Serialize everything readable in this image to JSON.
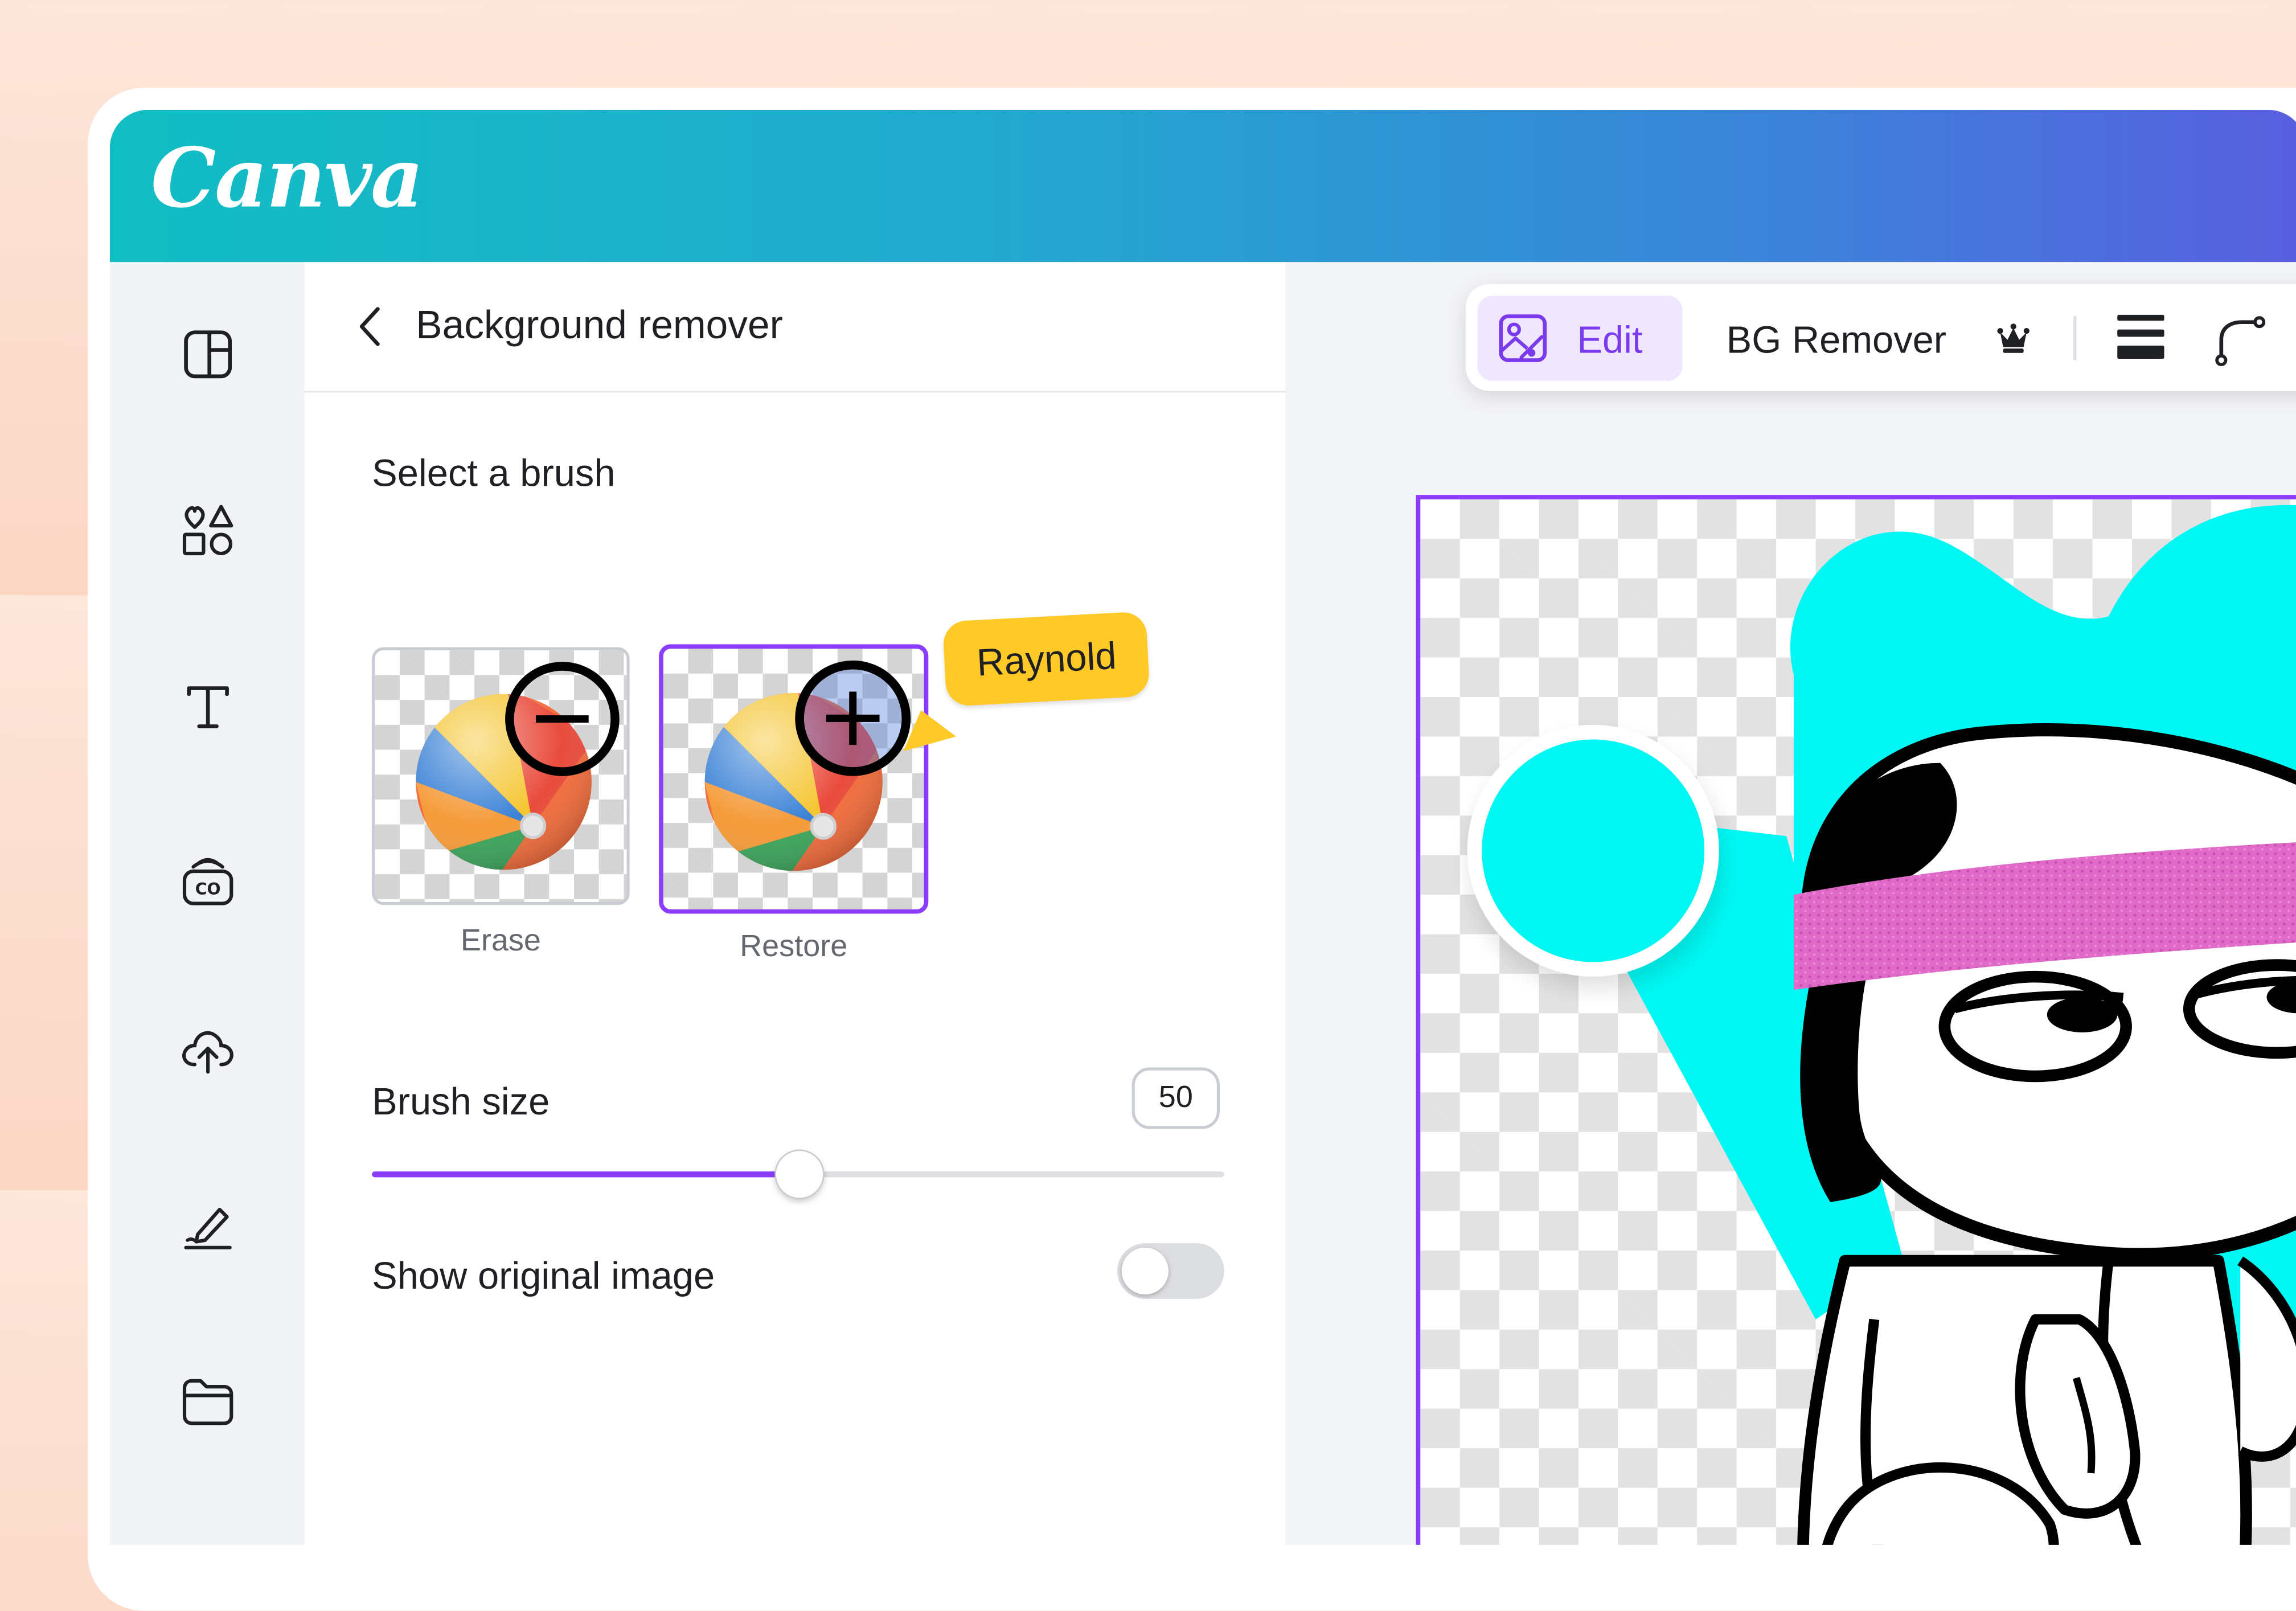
{
  "app": {
    "logo_text": "Canva"
  },
  "sidebar": {
    "items": [
      {
        "icon": "layout-panel-icon"
      },
      {
        "icon": "elements-shapes-icon"
      },
      {
        "icon": "text-icon"
      },
      {
        "icon": "brand-co-icon"
      },
      {
        "icon": "cloud-upload-icon"
      },
      {
        "icon": "draw-pen-icon"
      },
      {
        "icon": "folder-icon"
      }
    ]
  },
  "panel": {
    "title": "Background remover",
    "brush_section_label": "Select a brush",
    "brushes": [
      {
        "label": "Erase",
        "selected": false
      },
      {
        "label": "Restore",
        "selected": true
      }
    ],
    "collaborator_tag": "Raynold",
    "brush_size": {
      "label": "Brush size",
      "value": "50",
      "slider_fraction": 0.5
    },
    "show_original": {
      "label": "Show original image",
      "enabled": false
    }
  },
  "toolbar": {
    "edit_label": "Edit",
    "bg_remover_label": "BG Remover"
  },
  "colors": {
    "accent": "#8b3dff",
    "tooltip": "#ffc928",
    "cyan": "#00f8f4",
    "pink": "#e06ac8"
  }
}
